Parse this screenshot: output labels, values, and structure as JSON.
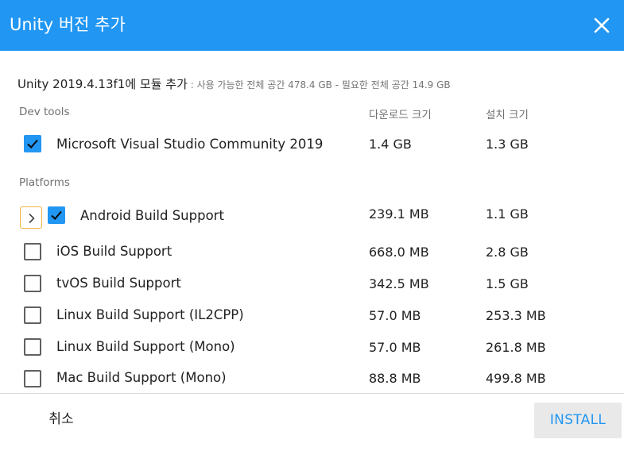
{
  "header": {
    "title": "Unity 버전 추가",
    "close_icon": "close-icon"
  },
  "subtitle": {
    "main": "Unity 2019.4.13f1에 모듈 추가",
    "detail": " : 사용 가능한 전체 공간 478.4 GB - 필요한 전체 공간 14.9 GB"
  },
  "columns": {
    "download_size": "다운로드 크기",
    "install_size": "설치 크기"
  },
  "sections": {
    "dev_tools": "Dev tools",
    "platforms": "Platforms"
  },
  "modules": [
    {
      "name": "Microsoft Visual Studio Community 2019",
      "download": "1.4 GB",
      "install": "1.3 GB",
      "checked": true
    },
    {
      "name": "Android Build Support",
      "download": "239.1 MB",
      "install": "1.1 GB",
      "checked": true,
      "expandable": true
    },
    {
      "name": "iOS Build Support",
      "download": "668.0 MB",
      "install": "2.8 GB",
      "checked": false
    },
    {
      "name": "tvOS Build Support",
      "download": "342.5 MB",
      "install": "1.5 GB",
      "checked": false
    },
    {
      "name": "Linux Build Support (IL2CPP)",
      "download": "57.0 MB",
      "install": "253.3 MB",
      "checked": false
    },
    {
      "name": "Linux Build Support (Mono)",
      "download": "57.0 MB",
      "install": "261.8 MB",
      "checked": false
    },
    {
      "name": "Mac Build Support (Mono)",
      "download": "88.8 MB",
      "install": "499.8 MB",
      "checked": false
    }
  ],
  "footer": {
    "cancel_label": "취소",
    "install_label": "INSTALL"
  },
  "colors": {
    "accent": "#2196f3",
    "expander_border": "#f0b240"
  }
}
